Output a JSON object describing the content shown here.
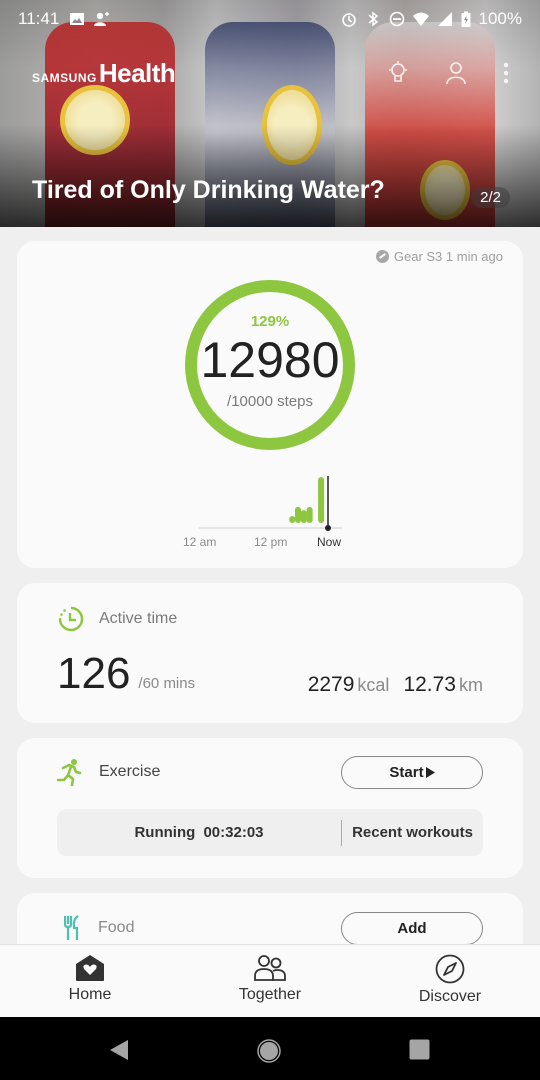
{
  "status_bar": {
    "time": "11:41",
    "left_icons": [
      "image-icon",
      "contact-add-icon"
    ],
    "right_icons": [
      "alarm-icon",
      "bluetooth-icon",
      "do-not-disturb-icon",
      "wifi-icon",
      "signal-icon",
      "battery-charging-icon"
    ],
    "battery": "100%"
  },
  "app": {
    "brand_prefix": "SAMSUNG",
    "brand_name": "Health",
    "actions": [
      "lightbulb-icon",
      "profile-icon",
      "more-options-icon"
    ]
  },
  "hero": {
    "title": "Tired of Only Drinking Water?",
    "counter": "2/2"
  },
  "steps": {
    "source": "Gear S3 1 min ago",
    "percent_label": "129%",
    "count": "12980",
    "goal_label": "/10000 steps",
    "progress_fraction": 1.298,
    "accent": "#8dc63f",
    "timeline": {
      "labels": [
        "12 am",
        "12 pm",
        "Now"
      ],
      "bars": [
        {
          "hour": 15.5,
          "value": 0.15
        },
        {
          "hour": 16.5,
          "value": 0.35
        },
        {
          "hour": 17.5,
          "value": 0.28
        },
        {
          "hour": 18.5,
          "value": 0.35
        },
        {
          "hour": 20.5,
          "value": 1.0
        }
      ]
    }
  },
  "active_time": {
    "label": "Active time",
    "value": "126",
    "goal": "/60 mins",
    "kcal_value": "2279",
    "kcal_unit": "kcal",
    "distance_value": "12.73",
    "distance_unit": "km"
  },
  "exercise": {
    "label": "Exercise",
    "start_label": "Start",
    "last_workout_type": "Running",
    "last_workout_duration": "00:32:03",
    "recent_label": "Recent workouts"
  },
  "food": {
    "label": "Food",
    "add_label": "Add"
  },
  "bottom_nav": {
    "items": [
      {
        "label": "Home",
        "icon": "home-heart-icon",
        "active": true
      },
      {
        "label": "Together",
        "icon": "people-icon",
        "active": false
      },
      {
        "label": "Discover",
        "icon": "compass-icon",
        "active": false
      }
    ]
  },
  "system_nav": [
    "back-button",
    "home-button",
    "recents-button"
  ]
}
